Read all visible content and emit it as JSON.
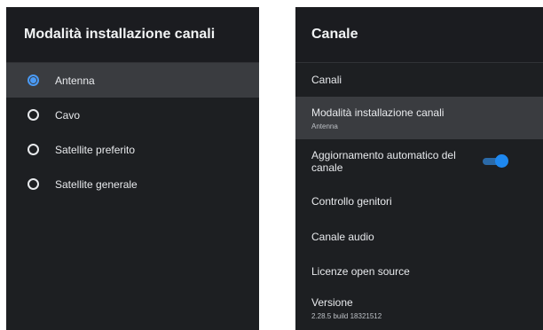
{
  "install_mode_panel": {
    "title": "Modalità installazione canali",
    "options": [
      {
        "label": "Antenna",
        "selected": true
      },
      {
        "label": "Cavo",
        "selected": false
      },
      {
        "label": "Satellite preferito",
        "selected": false
      },
      {
        "label": "Satellite generale",
        "selected": false
      }
    ]
  },
  "channel_panel": {
    "title": "Canale",
    "items": [
      {
        "label": "Canali"
      },
      {
        "label": "Modalità installazione canali",
        "value": "Antenna"
      },
      {
        "label": "Aggiornamento automatico del canale",
        "toggle_on": true
      },
      {
        "label": "Controllo genitori"
      },
      {
        "label": "Canale audio"
      },
      {
        "label": "Licenze open source"
      },
      {
        "label": "Versione",
        "value": "2.28.5 build 18321512"
      }
    ]
  },
  "colors": {
    "panel_bg": "#1d1f22",
    "highlight_bg": "#3a3c40",
    "accent": "#4a9af5",
    "toggle_thumb": "#1e88f0"
  }
}
